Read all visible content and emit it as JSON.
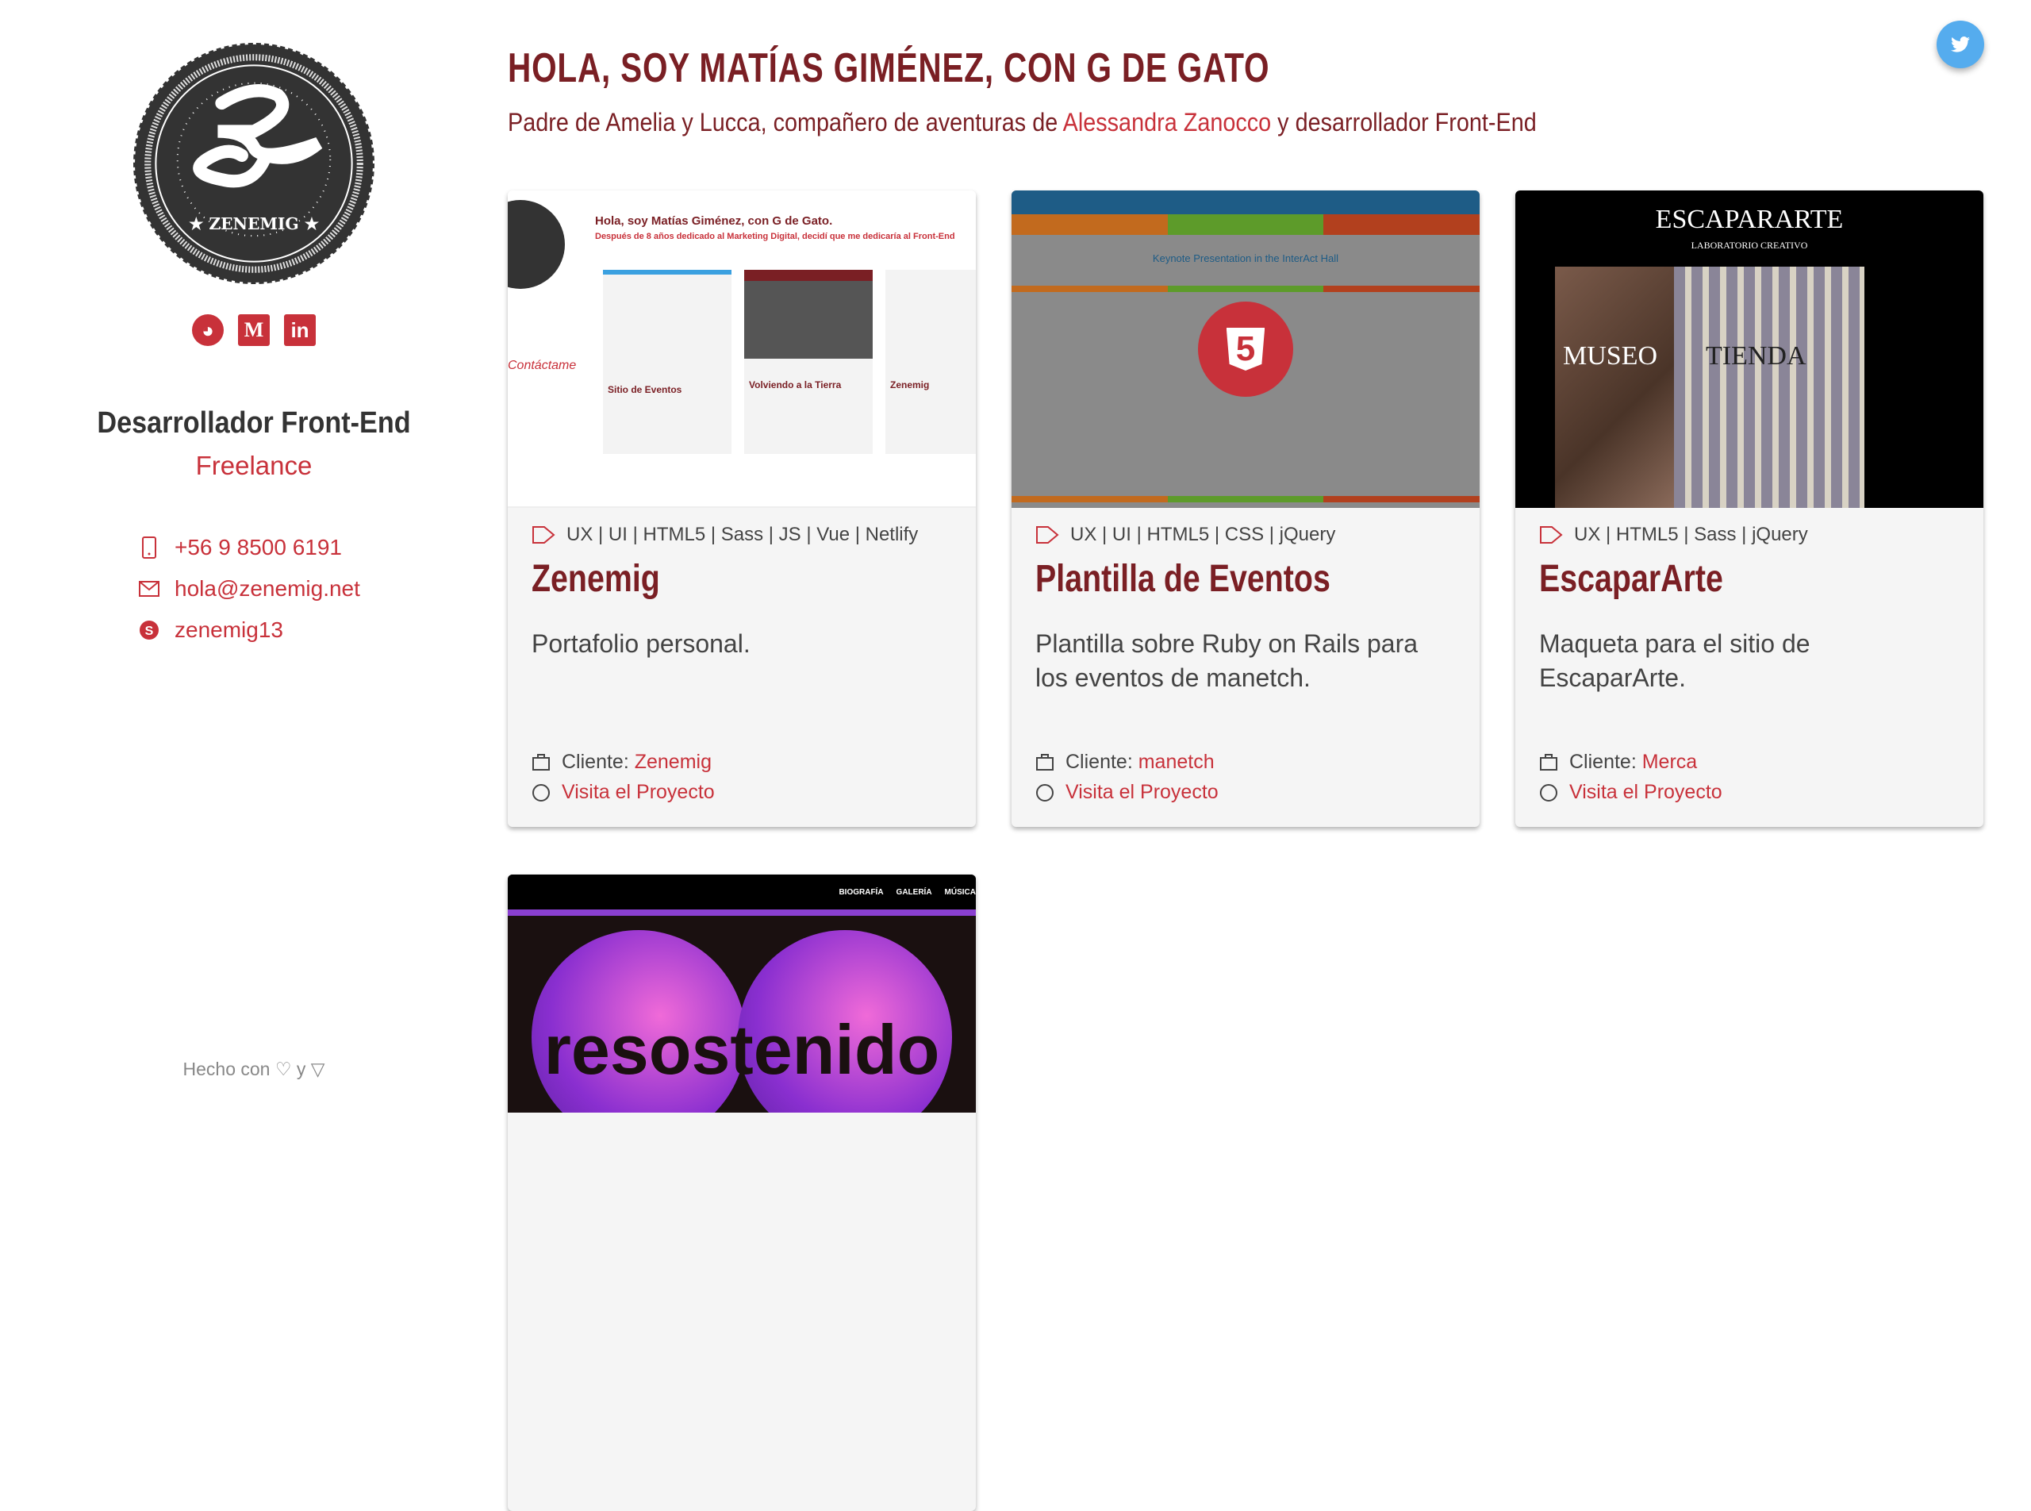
{
  "sidebar": {
    "logo_text": "ZENEMIG",
    "social": [
      {
        "icon": "github-icon"
      },
      {
        "icon": "medium-icon",
        "label": "M"
      },
      {
        "icon": "linkedin-icon",
        "label": "in"
      }
    ],
    "role": "Desarrollador Front-End",
    "status": "Freelance",
    "contacts": {
      "phone": "+56 9 8500 6191",
      "email": "hola@zenemig.net",
      "skype": "zenemig13"
    },
    "footer": {
      "prefix": "Hecho con",
      "and": "y"
    }
  },
  "header": {
    "title": "Hola, soy Matías Giménez, con G de Gato",
    "subtitle_pre": "Padre de Amelia y Lucca, compañero de aventuras de ",
    "subtitle_link": "Alessandra Zanocco",
    "subtitle_post": " y desarrollador Front-End"
  },
  "colors": {
    "accent": "#c8313a",
    "dark_red": "#7a1f24",
    "twitter": "#55acee"
  },
  "projects": [
    {
      "tags": "UX | UI | HTML5 | Sass | JS | Vue | Netlify",
      "title": "Zenemig",
      "description": "Portafolio personal.",
      "client_label": "Cliente:",
      "client": "Zenemig",
      "visit": "Visita el Proyecto",
      "preview": {
        "heading": "Hola, soy Matías Giménez, con G de Gato.",
        "sub": "Después de 8 años dedicado al Marketing Digital, decidí que me dedicaría al Front-End",
        "items": [
          "Sitio de Eventos",
          "Volviendo a la Tierra",
          "Zenemig"
        ],
        "contact": "Contáctame"
      }
    },
    {
      "tags": "UX | UI | HTML5 | CSS | jQuery",
      "title": "Plantilla de Eventos",
      "description": "Plantilla sobre Ruby on Rails para los eventos de manetch.",
      "client_label": "Cliente:",
      "client": "manetch",
      "visit": "Visita el Proyecto",
      "preview": {
        "heading": "Keynote Presentation in the InterAct Hall",
        "badge": "5"
      }
    },
    {
      "tags": "UX | HTML5 | Sass | jQuery",
      "title": "EscaparArte",
      "description": "Maqueta para el sitio de EscaparArte.",
      "client_label": "Cliente:",
      "client": "Merca",
      "visit": "Visita el Proyecto",
      "preview": {
        "brand": "EscaparArte",
        "tagline": "Laboratorio Creativo",
        "left": "Museo",
        "right": "Tienda"
      }
    },
    {
      "preview": {
        "nav": [
          "Biografía",
          "Galería",
          "Música"
        ],
        "logo": "resostenido"
      }
    }
  ]
}
